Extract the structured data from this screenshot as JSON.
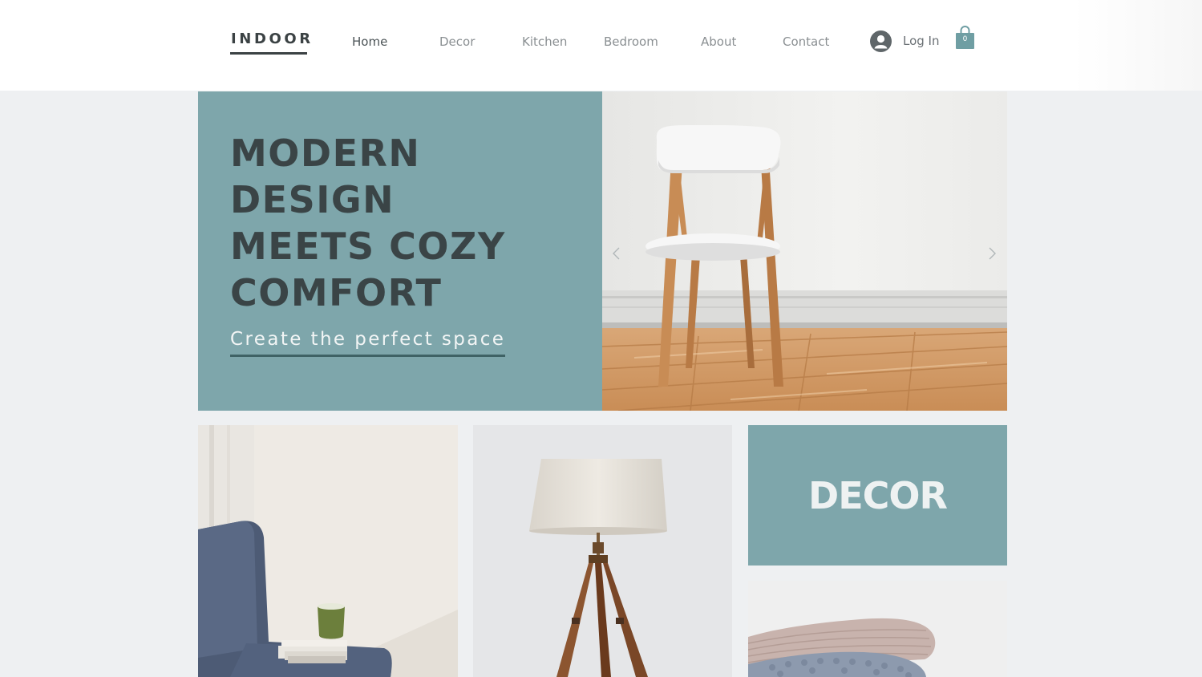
{
  "header": {
    "logo": "INDOOR",
    "nav": [
      {
        "label": "Home",
        "active": true
      },
      {
        "label": "Decor",
        "active": false
      },
      {
        "label": "Kitchen",
        "active": false
      },
      {
        "label": "Bedroom",
        "active": false
      },
      {
        "label": "About",
        "active": false
      },
      {
        "label": "Contact",
        "active": false
      }
    ],
    "login_label": "Log In",
    "cart_count": "0"
  },
  "hero": {
    "title_lines": [
      "MODERN",
      "DESIGN",
      "MEETS COZY",
      "COMFORT"
    ],
    "cta": "Create the perfect space",
    "image_icon": "white-chair-photo",
    "panel_color": "#7ea6ab"
  },
  "tiles": {
    "tile1_icon": "armchair-books-mug-photo",
    "tile2_icon": "tripod-lamp-photo",
    "decor_label": "DECOR",
    "tile4_icon": "knit-blankets-photo"
  },
  "colors": {
    "accent": "#7ea6ab",
    "dark_text": "#3a4446",
    "background": "#eef0f2"
  }
}
